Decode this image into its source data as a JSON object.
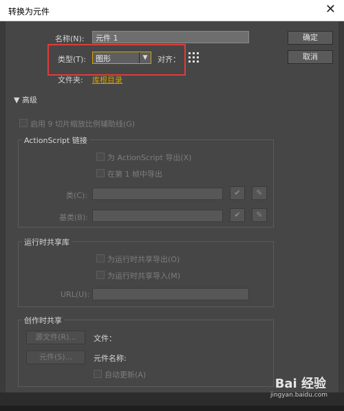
{
  "window": {
    "title": "转换为元件",
    "close": "✕"
  },
  "form": {
    "name_label": "名称(N):",
    "name_value": "元件 1",
    "type_label": "类型(T):",
    "type_value": "图形",
    "align_label": "对齐：",
    "folder_label": "文件夹:",
    "folder_value": "库根目录"
  },
  "buttons": {
    "ok": "确定",
    "cancel": "取消"
  },
  "advanced": {
    "toggle": "▼ 高级",
    "nine_slice": "启用 9 切片缩放比例辅助线(G)",
    "actionscript_group": "ActionScript 链接",
    "export_as": "为 ActionScript 导出(X)",
    "export_frame1": "在第 1 帧中导出",
    "class_label": "类(C):",
    "base_class_label": "基类(B):",
    "runtime_group": "运行时共享库",
    "export_runtime": "为运行时共享导出(O)",
    "import_runtime": "为运行时共享导入(M)",
    "url_label": "URL(U):",
    "authoring_group": "创作时共享",
    "source_file_btn": "源文件(R)...",
    "file_label": "文件：",
    "symbol_btn": "元件(S)...",
    "symbol_name_label": "元件名称:",
    "auto_update": "自动更新(A)"
  },
  "watermark": {
    "brand": "Bai 经验",
    "url": "jingyan.baidu.com"
  }
}
